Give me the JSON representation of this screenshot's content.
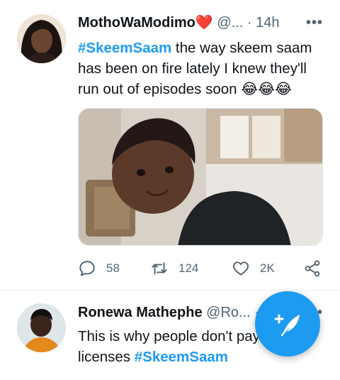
{
  "tweets": [
    {
      "author_name": "MothoWaModimo",
      "author_emoji": "❤️",
      "handle": "@...",
      "separator": "·",
      "time": "14h",
      "more_label": "•••",
      "hashtag": "#SkeemSaam",
      "text": " the way skeem saam has been on fire lately I knew they'll run out of episodes soon 😂😂😂",
      "has_media": true,
      "stats": {
        "replies": "58",
        "retweets": "124",
        "likes": "2K"
      }
    },
    {
      "author_name": "Ronewa Mathephe",
      "handle": "@Ro...",
      "separator": "·",
      "more_label": "•",
      "text": "This is why people don't pay licenses ",
      "hashtag": "#SkeemSaam"
    }
  ],
  "compose_button": {
    "icon": "feather-plus-icon"
  },
  "colors": {
    "accent": "#1d9bf0",
    "text": "#0f1419",
    "secondary": "#536471",
    "heart": "#e0245e"
  }
}
